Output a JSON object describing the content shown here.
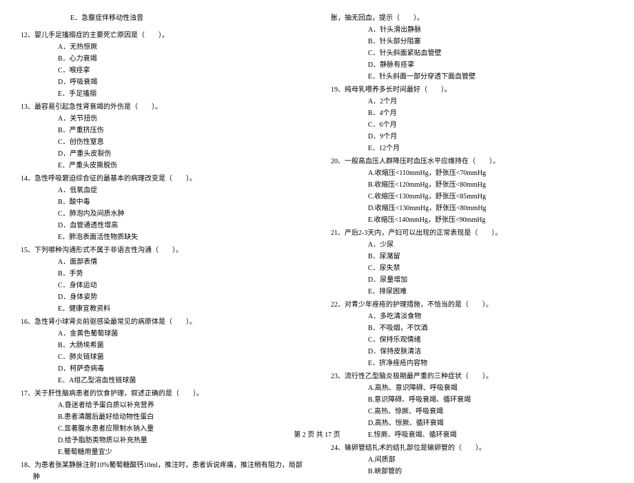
{
  "left": {
    "leadE": "E．急腹症伴移动性浊音",
    "q12": {
      "stem": "12、婴儿手足搐搦症的主要死亡原因是（　　）。",
      "opts": [
        "A．无热惊厥",
        "B．心力衰竭",
        "C．喉痉挛",
        "D．呼吸衰竭",
        "E．手足搐搦"
      ]
    },
    "q13": {
      "stem": "13、最容易引起急性肾衰竭的外伤是（　　）。",
      "opts": [
        "A．关节扭伤",
        "B．严重挤压伤",
        "C．创伤性窒息",
        "D．严重头皮裂伤",
        "E．严重头皮撕脱伤"
      ]
    },
    "q14": {
      "stem": "14、急性呼吸窘迫综合征的最基本的病理改变是（　　）。",
      "opts": [
        "A．低氧血症",
        "B．酸中毒",
        "C．肺泡内及间质水肿",
        "D．血管通透性增高",
        "E．肺泡表面活性物质缺失"
      ]
    },
    "q15": {
      "stem": "15、下列哪种沟通形式不属于非语言性沟通（　　）。",
      "opts": [
        "A．面部表情",
        "B．手势",
        "C．身体运动",
        "D．身体姿势",
        "E．健康宣教资料"
      ]
    },
    "q16": {
      "stem": "16、急性肾小球肾炎前驱感染最常见的病原体是（　　）。",
      "opts": [
        "A．金黄色葡萄球菌",
        "B．大肠埃希菌",
        "C．肺炎链球菌",
        "D．柯萨奇病毒",
        "E．A组乙型溶血性链球菌"
      ]
    },
    "q17": {
      "stem": "17、关于肝性脑病患者的饮食护理，叙述正确的是（　　）。",
      "opts": [
        "A.昏迷者给予蛋白质以补充营养",
        "B.患者清醒后最好给动物性蛋白",
        "C.显著腹水患者应限制水钠入量",
        "D.给予脂肪类物质以补充热量",
        "E.葡萄糖用量宜少"
      ]
    },
    "q18": {
      "stem": "18、为患者张某静脉注射10%葡萄糖酸钙10ml，推注时，患者诉说疼痛，推注稍有阻力，局部肿"
    }
  },
  "right": {
    "cont": "胀，抽无回血，提示（　　）。",
    "q18opts": [
      "A．针头滑出静脉",
      "B．针头部分阻塞",
      "C．针头斜面紧贴血管壁",
      "D．静脉有痉挛",
      "E．针头斜面一部分穿透下面血管壁"
    ],
    "q19": {
      "stem": "19、纯母乳喂养多长时间最好（　　）。",
      "opts": [
        "A．2个月",
        "B．4个月",
        "C．6个月",
        "D．9个月",
        "E．12个月"
      ]
    },
    "q20": {
      "stem": "20、一般高血压人群降压时血压水平应维持在（　　）。",
      "opts": [
        "A.收缩压<110mmHg，舒张压<70mmHg",
        "B.收缩压<120mmHg，舒张压<80mmHg",
        "C.收缩压<130mmHg，舒张压<85mmHg",
        "D.收缩压<130mmHg，舒张压<80mmHg",
        "E.收缩压<140mmHg，舒张压<90mmHg"
      ]
    },
    "q21": {
      "stem": "21、产后2-3天内，产妇可以出现的正常表现是（　　）。",
      "opts": [
        "A．少尿",
        "B．尿潴留",
        "C．尿失禁",
        "D．尿量增加",
        "E．排尿困难"
      ]
    },
    "q22": {
      "stem": "22、对青少年痤疮的护理措施，不恰当的是（　　）。",
      "opts": [
        "A．多吃清淡食物",
        "B．不吸烟，不饮酒",
        "C．保持乐观情绪",
        "D．保持皮肤清洁",
        "E．挤净痤疮内容物"
      ]
    },
    "q23": {
      "stem": "23、流行性乙型脑炎极期最严重的三种症状（　　）。",
      "opts": [
        "A.高热、意识障碍、呼吸衰竭",
        "B.意识障碍、呼吸衰竭、循环衰竭",
        "C.高热、惊厥、呼吸衰竭",
        "D.高热、惊厥、循环衰竭",
        "E.惊厥、呼吸衰竭、循环衰竭"
      ]
    },
    "q24": {
      "stem": "24、输卵管结扎术的结扎部位是输卵管的（　　）。",
      "opts": [
        "A.间质部",
        "B.峡部管的"
      ]
    }
  },
  "footer": "第 2 页 共 17 页"
}
